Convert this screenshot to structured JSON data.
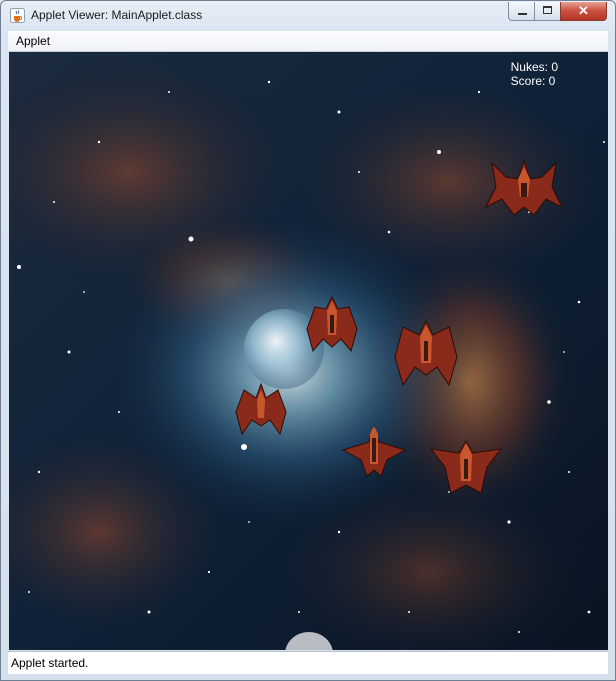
{
  "window": {
    "title": "Applet Viewer: MainApplet.class",
    "close_glyph": "✕"
  },
  "menubar": {
    "items": [
      "Applet"
    ]
  },
  "hud": {
    "nukes_label": "Nukes: 0",
    "score_label": "Score: 0"
  },
  "status": {
    "text": "Applet started."
  },
  "icons": {
    "app_icon": "java-coffee-cup-icon"
  },
  "colors": {
    "ship_hull": "#8a2a1a",
    "ship_accent": "#c8572d",
    "space_bg": "#0d1a2b",
    "close_button": "#c9503d"
  }
}
